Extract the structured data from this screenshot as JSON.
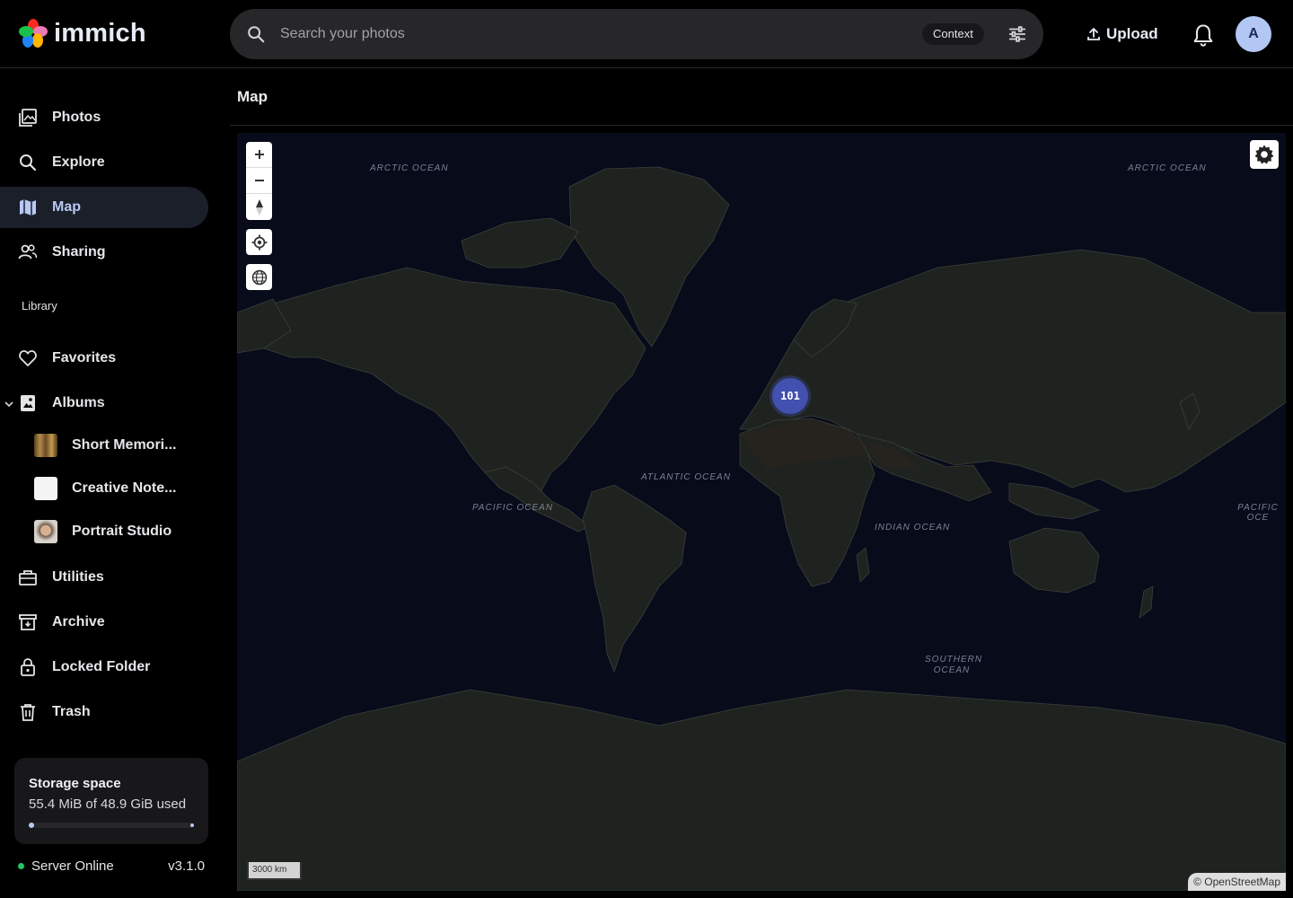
{
  "app": {
    "logo_text": "immich"
  },
  "search": {
    "placeholder": "Search your photos",
    "context_label": "Context"
  },
  "header": {
    "upload_label": "Upload",
    "avatar_initial": "A"
  },
  "sidebar": {
    "items": [
      {
        "label": "Photos",
        "icon": "photos-icon"
      },
      {
        "label": "Explore",
        "icon": "magnify-icon"
      },
      {
        "label": "Map",
        "icon": "map-icon",
        "active": true
      },
      {
        "label": "Sharing",
        "icon": "people-icon"
      }
    ],
    "library_heading": "Library",
    "library_items": [
      {
        "label": "Favorites",
        "icon": "heart-icon"
      },
      {
        "label": "Albums",
        "icon": "album-icon"
      }
    ],
    "albums": [
      {
        "label": "Short Memori...",
        "thumb_color": "#8a6b3a"
      },
      {
        "label": "Creative Note...",
        "thumb_color": "#f2f2f2"
      },
      {
        "label": "Portrait Studio",
        "thumb_color": "#c9a58a"
      }
    ],
    "bottom_items": [
      {
        "label": "Utilities",
        "icon": "toolbox-icon"
      },
      {
        "label": "Archive",
        "icon": "archive-icon"
      },
      {
        "label": "Locked Folder",
        "icon": "lock-icon"
      },
      {
        "label": "Trash",
        "icon": "trash-icon"
      }
    ]
  },
  "storage": {
    "title": "Storage space",
    "usage_text": "55.4 MiB of 48.9 GiB used",
    "used_fraction": 0.0011
  },
  "server": {
    "status": "Server Online",
    "version": "v3.1.0"
  },
  "page": {
    "title": "Map"
  },
  "map": {
    "ocean_labels": [
      "ARCTIC OCEAN",
      "ARCTIC OCEAN",
      "ATLANTIC OCEAN",
      "PACIFIC OCEAN",
      "INDIAN OCEAN",
      "SOUTHERN OCEAN",
      "PACIFIC OCE"
    ],
    "cluster_count": "101",
    "scale_label": "3000 km",
    "attribution": "© OpenStreetMap"
  },
  "colors": {
    "accent": "#b7c9f3",
    "cluster": "#4250af",
    "online": "#22c55e"
  }
}
